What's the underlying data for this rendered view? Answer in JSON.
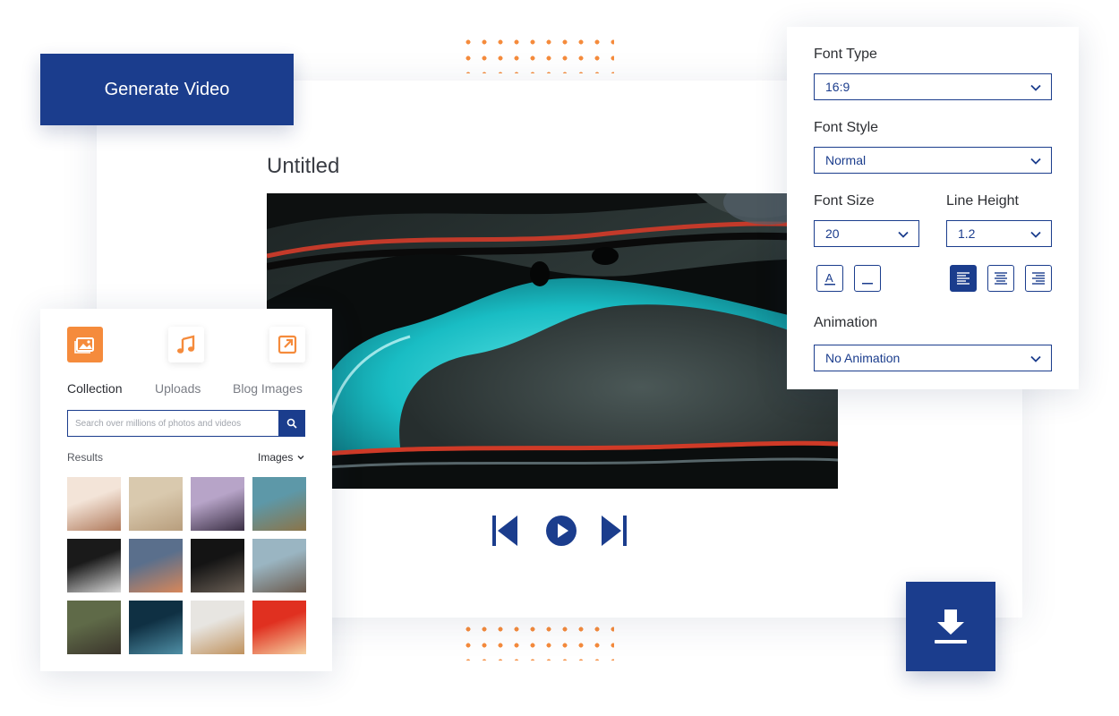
{
  "generate_button": {
    "label": "Generate Video"
  },
  "project": {
    "title": "Untitled"
  },
  "colors": {
    "primary": "#1b3d8d",
    "accent": "#f58b3c"
  },
  "player": {
    "controls": [
      {
        "name": "skip-back",
        "icon": "skip-back-icon"
      },
      {
        "name": "play",
        "icon": "play-icon"
      },
      {
        "name": "skip-forward",
        "icon": "skip-forward-icon"
      }
    ]
  },
  "font_panel": {
    "font_type": {
      "label": "Font Type",
      "value": "16:9"
    },
    "font_style": {
      "label": "Font Style",
      "value": "Normal"
    },
    "font_size": {
      "label": "Font Size",
      "value": "20"
    },
    "line_height": {
      "label": "Line Height",
      "value": "1.2"
    },
    "format_buttons": [
      {
        "name": "text-color",
        "icon": "text-color-icon",
        "glyph": "A"
      },
      {
        "name": "underline",
        "icon": "underline-icon",
        "glyph": "_"
      }
    ],
    "align_buttons": [
      {
        "name": "align-left",
        "icon": "align-left-icon",
        "active": true
      },
      {
        "name": "align-center",
        "icon": "align-center-icon",
        "active": false
      },
      {
        "name": "align-right",
        "icon": "align-right-icon",
        "active": false
      }
    ],
    "animation": {
      "label": "Animation",
      "value": "No Animation"
    }
  },
  "media_panel": {
    "tabs": [
      {
        "label": "Collection",
        "icon": "image-gallery-icon",
        "active": true
      },
      {
        "label": "Uploads",
        "icon": "music-note-icon",
        "active": false
      },
      {
        "label": "Blog Images",
        "icon": "external-link-icon",
        "active": false
      }
    ],
    "search": {
      "placeholder": "Search over millions of photos and videos",
      "icon": "search-icon"
    },
    "results_label": "Results",
    "filter": {
      "value": "Images",
      "icon": "chevron-down-icon"
    },
    "thumbnails": [
      {
        "name": "light-portrait",
        "colors": [
          "#f3e4d8",
          "#b07a5c"
        ]
      },
      {
        "name": "statue",
        "colors": [
          "#d9c9ae",
          "#b89e7d"
        ]
      },
      {
        "name": "studio-mixer",
        "colors": [
          "#b7a4c8",
          "#3a2f44"
        ]
      },
      {
        "name": "mountain-road",
        "colors": [
          "#5d98a8",
          "#8b7448"
        ]
      },
      {
        "name": "night-walker",
        "colors": [
          "#1a1a1a",
          "#d7d7d7"
        ]
      },
      {
        "name": "cloudy-sunset",
        "colors": [
          "#5a6f8c",
          "#d8875a"
        ]
      },
      {
        "name": "dark-room",
        "colors": [
          "#141414",
          "#6a5f55"
        ]
      },
      {
        "name": "city-building",
        "colors": [
          "#9ab5c2",
          "#6b5a4d"
        ]
      },
      {
        "name": "stone-ruins",
        "colors": [
          "#5f6a48",
          "#3b352c"
        ]
      },
      {
        "name": "blue-night",
        "colors": [
          "#0f3043",
          "#4f8fa6"
        ]
      },
      {
        "name": "wooden-cabinet",
        "colors": [
          "#e7e5e1",
          "#c0925e"
        ]
      },
      {
        "name": "paint-splash",
        "colors": [
          "#e03020",
          "#f5d0a0"
        ]
      }
    ]
  },
  "download_button": {
    "icon": "download-icon"
  }
}
